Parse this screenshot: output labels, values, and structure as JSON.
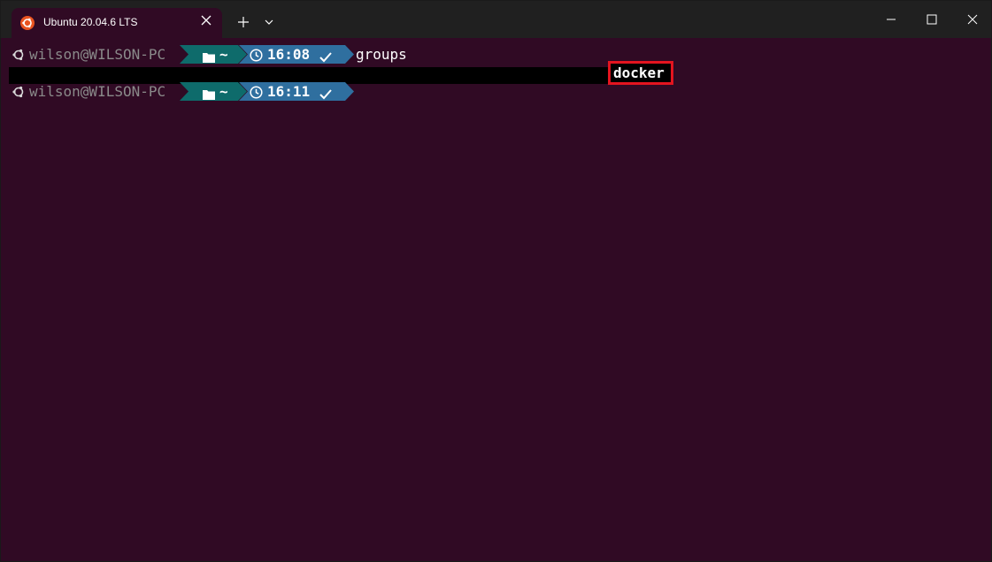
{
  "tab": {
    "title": "Ubuntu 20.04.6 LTS",
    "icon": "ubuntu-logo-icon",
    "accent": "#e95420"
  },
  "titlebar": {
    "new_tab_icon": "plus-icon",
    "dropdown_icon": "chevron-down-icon",
    "minimize_icon": "minimize-icon",
    "maximize_icon": "maximize-icon",
    "close_icon": "close-icon"
  },
  "terminal": {
    "background": "#300a24",
    "prompts": [
      {
        "user_host": "wilson@WILSON-PC",
        "dir": "~",
        "time": "16:08",
        "status_icon": "check-icon",
        "command": "groups"
      },
      {
        "user_host": "wilson@WILSON-PC",
        "dir": "~",
        "time": "16:11",
        "status_icon": "check-icon",
        "command": ""
      }
    ],
    "output": "docker",
    "highlight_color": "#e3141f",
    "segment_colors": {
      "dir": "#0e6b6b",
      "time": "#2f6f9f"
    }
  }
}
